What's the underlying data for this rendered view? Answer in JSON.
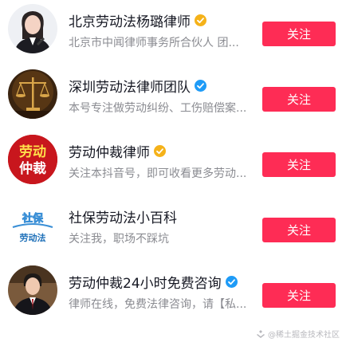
{
  "accounts": [
    {
      "name": "北京劳动法杨璐律师",
      "verified": "yellow",
      "description": "北京市中闻律师事务所合伙人 团...",
      "follow_label": "关注",
      "avatar_icon": "lawyer-portrait-icon"
    },
    {
      "name": "深圳劳动法律师团队",
      "verified": "blue",
      "description": "本号专注做劳动纠纷、工伤赔偿案...",
      "follow_label": "关注",
      "avatar_icon": "scales-of-justice-icon"
    },
    {
      "name": "劳动仲裁律师",
      "verified": "yellow",
      "description": "关注本抖音号，即可收看更多劳动...",
      "follow_label": "关注",
      "avatar_icon": "labor-arbitration-logo",
      "avatar_text": [
        "劳动",
        "仲裁"
      ]
    },
    {
      "name": "社保劳动法小百科",
      "verified": "none",
      "description": "关注我，职场不踩坑",
      "follow_label": "关注",
      "avatar_icon": "social-security-logo",
      "avatar_text": [
        "社保",
        "劳动法"
      ]
    },
    {
      "name": "劳动仲裁24小时免费咨询",
      "verified": "blue",
      "description": "律师在线，免费法律咨询，请【私...",
      "follow_label": "关注",
      "avatar_icon": "lawyer-portrait-icon"
    }
  ],
  "watermark": "@稀土掘金技术社区",
  "colors": {
    "follow_button": "#fe2c55",
    "verified_yellow": "#f5b219",
    "verified_blue": "#1e9bf7",
    "name_text": "#161823",
    "desc_text": "#8a8b91"
  }
}
